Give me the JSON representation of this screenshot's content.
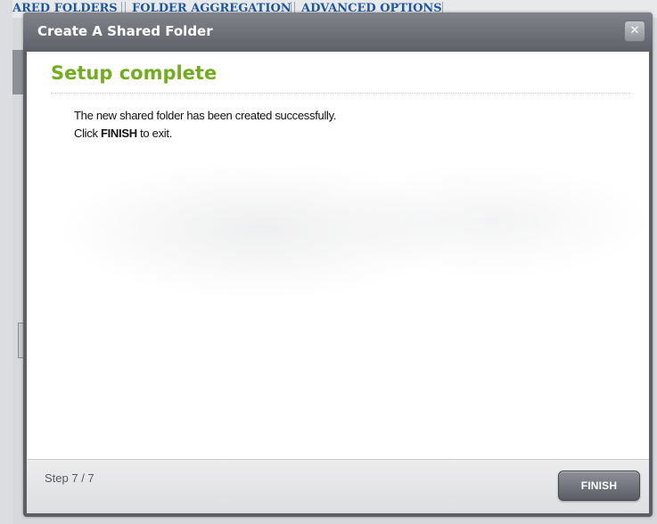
{
  "background": {
    "tabs": [
      "ARED FOLDERS",
      "FOLDER AGGREGATION",
      "ADVANCED OPTIONS"
    ]
  },
  "dialog": {
    "title": "Create A Shared Folder",
    "close_icon": "close-icon",
    "heading": "Setup complete",
    "message_line1": "The new shared folder has been created successfully.",
    "message_line2_prefix": "Click ",
    "message_line2_bold": "FINISH",
    "message_line2_suffix": " to exit.",
    "step": "Step 7 / 7",
    "finish_label": "FINISH"
  },
  "colors": {
    "heading": "#72ad20",
    "titlebar": "#6a6d74",
    "tab_text": "#1f56a0"
  }
}
